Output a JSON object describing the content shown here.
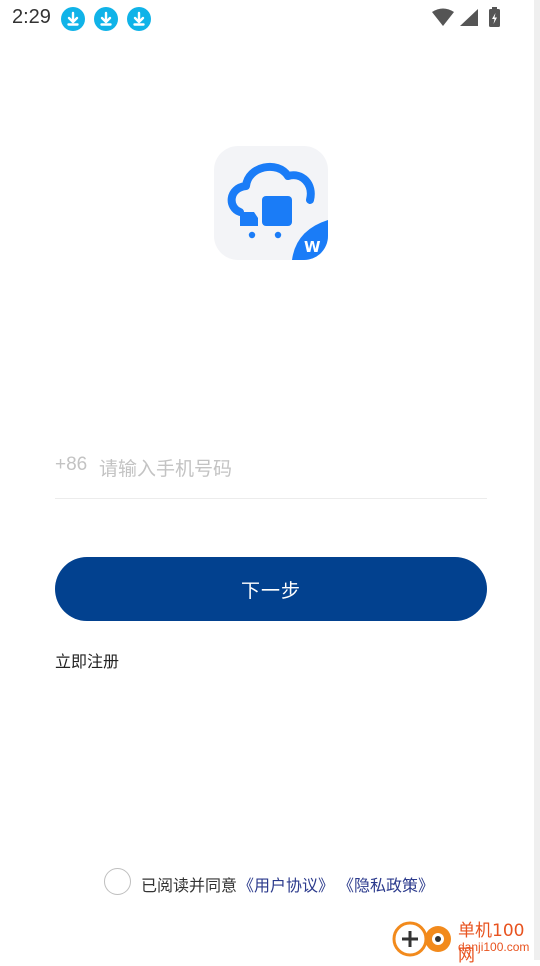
{
  "status_bar": {
    "time": "2:29",
    "icons": [
      "download-icon",
      "download-icon",
      "download-icon",
      "wifi-icon",
      "signal-icon",
      "battery-icon"
    ]
  },
  "app": {
    "logo_icon": "cloud-truck-logo-icon",
    "logo_badge_text": "W"
  },
  "login": {
    "phone_prefix": "+86",
    "phone_placeholder": "请输入手机号码",
    "phone_value": "",
    "next_button_label": "下一步",
    "register_link": "立即注册"
  },
  "agreement": {
    "checked": false,
    "text": "已阅读并同意",
    "user_agreement_link": "《用户协议》",
    "privacy_policy_link": "《隐私政策》"
  },
  "watermark": {
    "title": "单机100网",
    "url": "danji100.com"
  },
  "colors": {
    "primary": "#02418f",
    "link": "#2b3a8c",
    "logo_blue": "#1a7cf7",
    "download_badge": "#10b3e8",
    "watermark": "#e8531f"
  }
}
